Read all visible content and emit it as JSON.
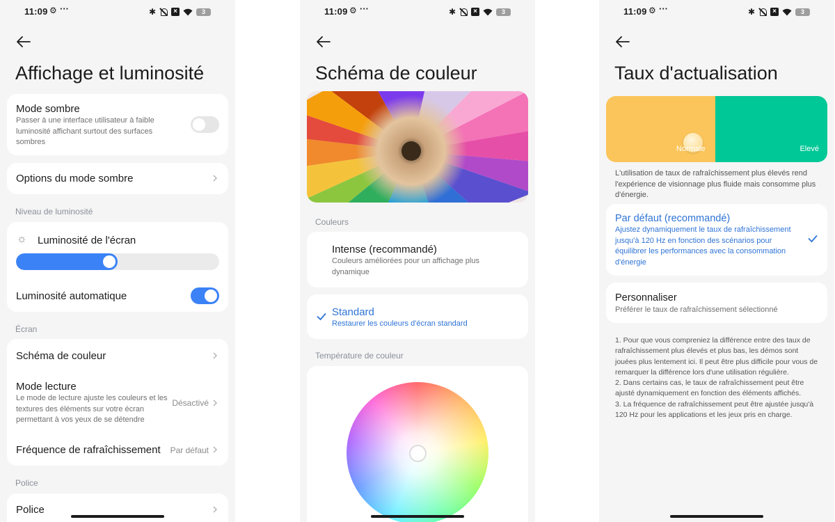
{
  "status_bar": {
    "time": "11:09",
    "overflow": "···",
    "battery": "3"
  },
  "screen1": {
    "title": "Affichage et luminosité",
    "dark_mode": {
      "title": "Mode sombre",
      "desc": "Passer à une interface utilisateur à faible luminosité affichant surtout des surfaces sombres",
      "enabled": false
    },
    "dark_options": {
      "title": "Options du mode sombre"
    },
    "brightness_section": "Niveau de luminosité",
    "screen_brightness": {
      "title": "Luminosité de l'écran",
      "level": 0.5
    },
    "auto_brightness": {
      "title": "Luminosité automatique",
      "enabled": true
    },
    "screen_section": "Écran",
    "color_scheme": {
      "title": "Schéma de couleur"
    },
    "reading_mode": {
      "title": "Mode lecture",
      "desc": "Le mode de lecture ajuste les couleurs et les textures des éléments sur votre écran permettant à vos yeux de se détendre",
      "value": "Désactivé"
    },
    "refresh": {
      "title": "Fréquence de rafraîchissement",
      "value": "Par défaut"
    },
    "font_section": "Police",
    "font": {
      "title": "Police"
    }
  },
  "screen2": {
    "title": "Schéma de couleur",
    "colors_section": "Couleurs",
    "intense": {
      "title": "Intense (recommandé)",
      "desc": "Couleurs améliorées pour un affichage plus dynamique"
    },
    "standard": {
      "title": "Standard",
      "desc": "Restaurer les couleurs d'écran standard",
      "selected": true
    },
    "temperature_section": "Température de couleur"
  },
  "screen3": {
    "title": "Taux d'actualisation",
    "label_normal": "Normale",
    "label_high": "Elevé",
    "intro": "L'utilisation de taux de rafraîchissement plus élevés rend l'expérience de visionnage plus fluide mais consomme plus d'énergie.",
    "default_option": {
      "title": "Par défaut (recommandé)",
      "desc": "Ajustez dynamiquement le taux de rafraîchissement jusqu'à 120 Hz en fonction des scénarios pour équilibrer les performances avec la consommation d'énergie",
      "selected": true
    },
    "custom_option": {
      "title": "Personnaliser",
      "desc": "Préférer le taux de rafraîchissement sélectionné"
    },
    "notes": "1. Pour que vous compreniez la différence entre des taux de rafraîchissement plus élevés et plus bas, les démos sont jouées plus lentement ici. Il peut être plus difficile pour vous de remarquer la différence lors d'une utilisation régulière.\n2. Dans certains cas, le taux de rafraîchissement peut être ajusté dynamiquement en fonction des éléments affichés.\n3. La fréquence de rafraîchissement peut être ajustée jusqu'à 120 Hz pour les applications et les jeux pris en charge."
  },
  "colors": {
    "accent": "#3b82f6",
    "selected_text": "#2f74d6",
    "normal_panel": "#fbc55b",
    "high_panel": "#00c896",
    "background": "#f5f5f5"
  }
}
